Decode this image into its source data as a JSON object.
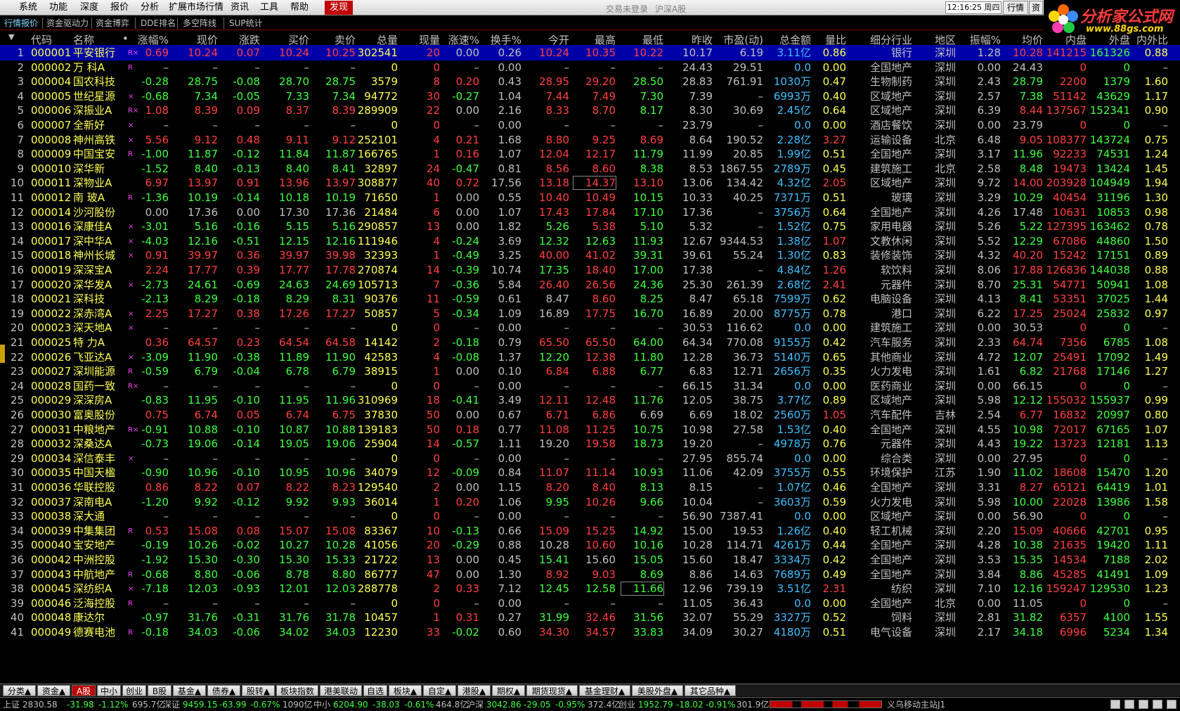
{
  "menu": {
    "items": [
      "系统",
      "功能",
      "深度",
      "报价",
      "分析",
      "扩展市场行情",
      "资讯",
      "工具",
      "帮助"
    ],
    "highlight": "发现",
    "center1": "交易未登录",
    "center2": "沪深A股",
    "clock": "12:16:25 周四",
    "btn_quote": "行情",
    "btn_trade": "资",
    "logo_text": "分析家公式网",
    "logo_url": "www.88gs.com"
  },
  "subtabs": [
    "行情报价",
    "资金驱动力",
    "资金博弈",
    "DDE排名",
    "多空阵线",
    "SUP统计"
  ],
  "headers": [
    "代码",
    "名称",
    "•",
    "涨幅%",
    "现价",
    "涨跌",
    "买价",
    "卖价",
    "总量",
    "现量",
    "涨速%",
    "换手%",
    "今开",
    "最高",
    "最低",
    "昨收",
    "市盈(动)",
    "总金额",
    "量比",
    "细分行业",
    "地区",
    "振幅%",
    "均价",
    "内盘",
    "外盘",
    "内外比"
  ],
  "rows": [
    [
      "1",
      "000001",
      "平安银行",
      "R×",
      "0.69",
      "10.24",
      "0.07",
      "10.24",
      "10.25",
      "302541",
      "20",
      "0.00",
      "0.26",
      "10.24",
      "10.35",
      "10.22",
      "10.17",
      "6.19",
      "3.11亿",
      "0.86",
      "银行",
      "深圳",
      "1.28",
      "10.28",
      "141215",
      "161326",
      "0.88"
    ],
    [
      "2",
      "000002",
      "万 科A",
      "R",
      "–",
      "–",
      "–",
      "–",
      "–",
      "0",
      "0",
      "–",
      "0.00",
      "–",
      "–",
      "–",
      "24.43",
      "29.51",
      "0.0",
      "0.00",
      "全国地产",
      "深圳",
      "0.00",
      "24.43",
      "0",
      "0",
      "–"
    ],
    [
      "3",
      "000004",
      "国农科技",
      "",
      "-0.28",
      "28.75",
      "-0.08",
      "28.70",
      "28.75",
      "3579",
      "8",
      "0.20",
      "0.43",
      "28.95",
      "29.20",
      "28.50",
      "28.83",
      "761.91",
      "1030万",
      "0.47",
      "生物制药",
      "深圳",
      "2.43",
      "28.79",
      "2200",
      "1379",
      "1.60"
    ],
    [
      "4",
      "000005",
      "世纪星源",
      "×",
      "-0.68",
      "7.34",
      "-0.05",
      "7.33",
      "7.34",
      "94772",
      "30",
      "-0.27",
      "1.04",
      "7.44",
      "7.49",
      "7.30",
      "7.39",
      "–",
      "6993万",
      "0.40",
      "区域地产",
      "深圳",
      "2.57",
      "7.38",
      "51142",
      "43629",
      "1.17"
    ],
    [
      "5",
      "000006",
      "深振业A",
      "R×",
      "1.08",
      "8.39",
      "0.09",
      "8.37",
      "8.39",
      "289909",
      "22",
      "0.00",
      "2.16",
      "8.33",
      "8.70",
      "8.17",
      "8.30",
      "30.69",
      "2.45亿",
      "0.64",
      "区域地产",
      "深圳",
      "6.39",
      "8.44",
      "137567",
      "152341",
      "0.90"
    ],
    [
      "6",
      "000007",
      "全新好",
      "×",
      "–",
      "–",
      "–",
      "–",
      "–",
      "0",
      "0",
      "–",
      "0.00",
      "–",
      "–",
      "–",
      "23.79",
      "–",
      "0.0",
      "0.00",
      "酒店餐饮",
      "深圳",
      "0.00",
      "23.79",
      "0",
      "0",
      "–"
    ],
    [
      "7",
      "000008",
      "神州高铁",
      "×",
      "5.56",
      "9.12",
      "0.48",
      "9.11",
      "9.12",
      "252101",
      "4",
      "0.21",
      "1.68",
      "8.80",
      "9.25",
      "8.69",
      "8.64",
      "190.52",
      "2.28亿",
      "3.27",
      "运输设备",
      "北京",
      "6.48",
      "9.05",
      "108377",
      "143724",
      "0.75"
    ],
    [
      "8",
      "000009",
      "中国宝安",
      "R",
      "-1.00",
      "11.87",
      "-0.12",
      "11.84",
      "11.87",
      "166765",
      "1",
      "0.16",
      "1.07",
      "12.04",
      "12.17",
      "11.79",
      "11.99",
      "20.85",
      "1.99亿",
      "0.51",
      "全国地产",
      "深圳",
      "3.17",
      "11.96",
      "92233",
      "74531",
      "1.24"
    ],
    [
      "9",
      "000010",
      "深华新",
      "",
      "-1.52",
      "8.40",
      "-0.13",
      "8.40",
      "8.41",
      "32897",
      "24",
      "-0.47",
      "0.81",
      "8.56",
      "8.60",
      "8.38",
      "8.53",
      "1867.55",
      "2789万",
      "0.45",
      "建筑施工",
      "北京",
      "2.58",
      "8.48",
      "19473",
      "13424",
      "1.45"
    ],
    [
      "10",
      "000011",
      "深物业A",
      "",
      "6.97",
      "13.97",
      "0.91",
      "13.96",
      "13.97",
      "308877",
      "40",
      "0.72",
      "17.56",
      "13.18",
      "14.37",
      "13.10",
      "13.06",
      "134.42",
      "4.32亿",
      "2.05",
      "区域地产",
      "深圳",
      "9.72",
      "14.00",
      "203928",
      "104949",
      "1.94"
    ],
    [
      "11",
      "000012",
      "南 玻A",
      "R",
      "-1.36",
      "10.19",
      "-0.14",
      "10.18",
      "10.19",
      "71650",
      "1",
      "0.00",
      "0.55",
      "10.40",
      "10.49",
      "10.15",
      "10.33",
      "40.25",
      "7371万",
      "0.51",
      "玻璃",
      "深圳",
      "3.29",
      "10.29",
      "40454",
      "31196",
      "1.30"
    ],
    [
      "12",
      "000014",
      "沙河股份",
      "",
      "0.00",
      "17.36",
      "0.00",
      "17.30",
      "17.36",
      "21484",
      "6",
      "0.00",
      "1.07",
      "17.43",
      "17.84",
      "17.10",
      "17.36",
      "–",
      "3756万",
      "0.64",
      "全国地产",
      "深圳",
      "4.26",
      "17.48",
      "10631",
      "10853",
      "0.98"
    ],
    [
      "13",
      "000016",
      "深康佳A",
      "×",
      "-3.01",
      "5.16",
      "-0.16",
      "5.15",
      "5.16",
      "290857",
      "13",
      "0.00",
      "1.82",
      "5.26",
      "5.38",
      "5.10",
      "5.32",
      "–",
      "1.52亿",
      "0.75",
      "家用电器",
      "深圳",
      "5.26",
      "5.22",
      "127395",
      "163462",
      "0.78"
    ],
    [
      "14",
      "000017",
      "深中华A",
      "×",
      "-4.03",
      "12.16",
      "-0.51",
      "12.15",
      "12.16",
      "111946",
      "4",
      "-0.24",
      "3.69",
      "12.32",
      "12.63",
      "11.93",
      "12.67",
      "9344.53",
      "1.38亿",
      "1.07",
      "文教休闲",
      "深圳",
      "5.52",
      "12.29",
      "67086",
      "44860",
      "1.50"
    ],
    [
      "15",
      "000018",
      "神州长城",
      "×",
      "0.91",
      "39.97",
      "0.36",
      "39.97",
      "39.98",
      "32393",
      "1",
      "-0.49",
      "3.25",
      "40.00",
      "41.02",
      "39.31",
      "39.61",
      "55.24",
      "1.30亿",
      "0.83",
      "装修装饰",
      "深圳",
      "4.32",
      "40.20",
      "15242",
      "17151",
      "0.89"
    ],
    [
      "16",
      "000019",
      "深深宝A",
      "",
      "2.24",
      "17.77",
      "0.39",
      "17.77",
      "17.78",
      "270874",
      "14",
      "-0.39",
      "10.74",
      "17.35",
      "18.40",
      "17.00",
      "17.38",
      "–",
      "4.84亿",
      "1.26",
      "软饮料",
      "深圳",
      "8.06",
      "17.88",
      "126836",
      "144038",
      "0.88"
    ],
    [
      "17",
      "000020",
      "深华发A",
      "×",
      "-2.73",
      "24.61",
      "-0.69",
      "24.63",
      "24.69",
      "105713",
      "7",
      "-0.36",
      "5.84",
      "26.40",
      "26.56",
      "24.36",
      "25.30",
      "261.39",
      "2.68亿",
      "2.41",
      "元器件",
      "深圳",
      "8.70",
      "25.31",
      "54771",
      "50941",
      "1.08"
    ],
    [
      "18",
      "000021",
      "深科技",
      "",
      "-2.13",
      "8.29",
      "-0.18",
      "8.29",
      "8.31",
      "90376",
      "11",
      "-0.59",
      "0.61",
      "8.47",
      "8.60",
      "8.25",
      "8.47",
      "65.18",
      "7599万",
      "0.62",
      "电脑设备",
      "深圳",
      "4.13",
      "8.41",
      "53351",
      "37025",
      "1.44"
    ],
    [
      "19",
      "000022",
      "深赤湾A",
      "×",
      "2.25",
      "17.27",
      "0.38",
      "17.26",
      "17.27",
      "50857",
      "5",
      "-0.34",
      "1.09",
      "16.89",
      "17.75",
      "16.70",
      "16.89",
      "20.00",
      "8775万",
      "0.78",
      "港口",
      "深圳",
      "6.22",
      "17.25",
      "25024",
      "25832",
      "0.97"
    ],
    [
      "20",
      "000023",
      "深天地A",
      "×",
      "–",
      "–",
      "–",
      "–",
      "–",
      "0",
      "0",
      "–",
      "0.00",
      "–",
      "–",
      "–",
      "30.53",
      "116.62",
      "0.0",
      "0.00",
      "建筑施工",
      "深圳",
      "0.00",
      "30.53",
      "0",
      "0",
      "–"
    ],
    [
      "21",
      "000025",
      "特 力A",
      "",
      "0.36",
      "64.57",
      "0.23",
      "64.54",
      "64.58",
      "14142",
      "2",
      "-0.18",
      "0.79",
      "65.50",
      "65.50",
      "64.00",
      "64.34",
      "770.08",
      "9155万",
      "0.42",
      "汽车服务",
      "深圳",
      "2.33",
      "64.74",
      "7356",
      "6785",
      "1.08"
    ],
    [
      "22",
      "000026",
      "飞亚达A",
      "×",
      "-3.09",
      "11.90",
      "-0.38",
      "11.89",
      "11.90",
      "42583",
      "4",
      "-0.08",
      "1.37",
      "12.20",
      "12.38",
      "11.80",
      "12.28",
      "36.73",
      "5140万",
      "0.65",
      "其他商业",
      "深圳",
      "4.72",
      "12.07",
      "25491",
      "17092",
      "1.49"
    ],
    [
      "23",
      "000027",
      "深圳能源",
      "R",
      "-0.59",
      "6.79",
      "-0.04",
      "6.78",
      "6.79",
      "38915",
      "1",
      "0.00",
      "0.10",
      "6.84",
      "6.88",
      "6.77",
      "6.83",
      "12.71",
      "2656万",
      "0.35",
      "火力发电",
      "深圳",
      "1.61",
      "6.82",
      "21768",
      "17146",
      "1.27"
    ],
    [
      "24",
      "000028",
      "国药一致",
      "R×",
      "–",
      "–",
      "–",
      "–",
      "–",
      "0",
      "0",
      "–",
      "0.00",
      "–",
      "–",
      "–",
      "66.15",
      "31.34",
      "0.0",
      "0.00",
      "医药商业",
      "深圳",
      "0.00",
      "66.15",
      "0",
      "0",
      "–"
    ],
    [
      "25",
      "000029",
      "深深房A",
      "",
      "-0.83",
      "11.95",
      "-0.10",
      "11.95",
      "11.96",
      "310969",
      "18",
      "-0.41",
      "3.49",
      "12.11",
      "12.48",
      "11.76",
      "12.05",
      "38.75",
      "3.77亿",
      "0.89",
      "区域地产",
      "深圳",
      "5.98",
      "12.12",
      "155032",
      "155937",
      "0.99"
    ],
    [
      "26",
      "000030",
      "富奥股份",
      "",
      "0.75",
      "6.74",
      "0.05",
      "6.74",
      "6.75",
      "37830",
      "50",
      "0.00",
      "0.67",
      "6.71",
      "6.86",
      "6.69",
      "6.69",
      "18.02",
      "2560万",
      "1.05",
      "汽车配件",
      "吉林",
      "2.54",
      "6.77",
      "16832",
      "20997",
      "0.80"
    ],
    [
      "27",
      "000031",
      "中粮地产",
      "R×",
      "-0.91",
      "10.88",
      "-0.10",
      "10.87",
      "10.88",
      "139183",
      "50",
      "0.18",
      "0.77",
      "11.08",
      "11.25",
      "10.75",
      "10.98",
      "27.58",
      "1.53亿",
      "0.40",
      "全国地产",
      "深圳",
      "4.55",
      "10.98",
      "72017",
      "67165",
      "1.07"
    ],
    [
      "28",
      "000032",
      "深桑达A",
      "",
      "-0.73",
      "19.06",
      "-0.14",
      "19.05",
      "19.06",
      "25904",
      "14",
      "-0.57",
      "1.11",
      "19.20",
      "19.58",
      "18.73",
      "19.20",
      "–",
      "4978万",
      "0.76",
      "元器件",
      "深圳",
      "4.43",
      "19.22",
      "13723",
      "12181",
      "1.13"
    ],
    [
      "29",
      "000034",
      "深信泰丰",
      "×",
      "–",
      "–",
      "–",
      "–",
      "–",
      "0",
      "0",
      "–",
      "0.00",
      "–",
      "–",
      "–",
      "27.95",
      "855.74",
      "0.0",
      "0.00",
      "综合类",
      "深圳",
      "0.00",
      "27.95",
      "0",
      "0",
      "–"
    ],
    [
      "30",
      "000035",
      "中国天楹",
      "",
      "-0.90",
      "10.96",
      "-0.10",
      "10.95",
      "10.96",
      "34079",
      "12",
      "-0.09",
      "0.84",
      "11.07",
      "11.14",
      "10.93",
      "11.06",
      "42.09",
      "3755万",
      "0.55",
      "环境保护",
      "江苏",
      "1.90",
      "11.02",
      "18608",
      "15470",
      "1.20"
    ],
    [
      "31",
      "000036",
      "华联控股",
      "",
      "0.86",
      "8.22",
      "0.07",
      "8.22",
      "8.23",
      "129540",
      "2",
      "0.00",
      "1.15",
      "8.20",
      "8.40",
      "8.13",
      "8.15",
      "–",
      "1.07亿",
      "0.46",
      "全国地产",
      "深圳",
      "3.31",
      "8.27",
      "65121",
      "64419",
      "1.01"
    ],
    [
      "32",
      "000037",
      "深南电A",
      "",
      "-1.20",
      "9.92",
      "-0.12",
      "9.92",
      "9.93",
      "36014",
      "1",
      "0.20",
      "1.06",
      "9.95",
      "10.26",
      "9.66",
      "10.04",
      "–",
      "3603万",
      "0.59",
      "火力发电",
      "深圳",
      "5.98",
      "10.00",
      "22028",
      "13986",
      "1.58"
    ],
    [
      "33",
      "000038",
      "深大通",
      "",
      "–",
      "–",
      "–",
      "–",
      "–",
      "0",
      "0",
      "–",
      "0.00",
      "–",
      "–",
      "–",
      "56.90",
      "7387.41",
      "0.0",
      "0.00",
      "区域地产",
      "深圳",
      "0.00",
      "56.90",
      "0",
      "0",
      "–"
    ],
    [
      "34",
      "000039",
      "中集集团",
      "R",
      "0.53",
      "15.08",
      "0.08",
      "15.07",
      "15.08",
      "83367",
      "10",
      "-0.13",
      "0.66",
      "15.09",
      "15.25",
      "14.92",
      "15.00",
      "19.53",
      "1.26亿",
      "0.40",
      "轻工机械",
      "深圳",
      "2.20",
      "15.09",
      "40666",
      "42701",
      "0.95"
    ],
    [
      "35",
      "000040",
      "宝安地产",
      "",
      "-0.19",
      "10.26",
      "-0.02",
      "10.27",
      "10.28",
      "41056",
      "20",
      "-0.29",
      "0.88",
      "10.28",
      "10.60",
      "10.16",
      "10.28",
      "114.71",
      "4261万",
      "0.44",
      "全国地产",
      "深圳",
      "4.28",
      "10.38",
      "21635",
      "19420",
      "1.11"
    ],
    [
      "36",
      "000042",
      "中洲控股",
      "",
      "-1.92",
      "15.30",
      "-0.30",
      "15.30",
      "15.33",
      "21722",
      "13",
      "0.00",
      "0.45",
      "15.41",
      "15.60",
      "15.05",
      "15.60",
      "18.47",
      "3334万",
      "0.42",
      "全国地产",
      "深圳",
      "3.53",
      "15.35",
      "14534",
      "7188",
      "2.02"
    ],
    [
      "37",
      "000043",
      "中航地产",
      "R",
      "-0.68",
      "8.80",
      "-0.06",
      "8.78",
      "8.80",
      "86777",
      "47",
      "0.00",
      "1.30",
      "8.92",
      "9.03",
      "8.69",
      "8.86",
      "14.63",
      "7689万",
      "0.49",
      "全国地产",
      "深圳",
      "3.84",
      "8.86",
      "45285",
      "41491",
      "1.09"
    ],
    [
      "38",
      "000045",
      "深纺织A",
      "×",
      "-7.18",
      "12.03",
      "-0.93",
      "12.01",
      "12.03",
      "288778",
      "2",
      "0.33",
      "7.12",
      "12.45",
      "12.58",
      "11.66",
      "12.96",
      "739.19",
      "3.51亿",
      "2.31",
      "纺织",
      "深圳",
      "7.10",
      "12.16",
      "159247",
      "129530",
      "1.23"
    ],
    [
      "39",
      "000046",
      "泛海控股",
      "R",
      "–",
      "–",
      "–",
      "–",
      "–",
      "0",
      "0",
      "–",
      "0.00",
      "–",
      "–",
      "–",
      "11.05",
      "36.43",
      "0.0",
      "0.00",
      "全国地产",
      "北京",
      "0.00",
      "11.05",
      "0",
      "0",
      "–"
    ],
    [
      "40",
      "000048",
      "康达尔",
      "",
      "-0.97",
      "31.76",
      "-0.31",
      "31.76",
      "31.78",
      "10457",
      "1",
      "0.31",
      "0.27",
      "31.99",
      "32.46",
      "31.56",
      "32.07",
      "55.29",
      "3327万",
      "0.52",
      "饲料",
      "深圳",
      "2.81",
      "31.82",
      "6357",
      "4100",
      "1.55"
    ],
    [
      "41",
      "000049",
      "德赛电池",
      "R",
      "-0.18",
      "34.03",
      "-0.06",
      "34.02",
      "34.03",
      "12230",
      "33",
      "-0.02",
      "0.60",
      "34.30",
      "34.57",
      "33.83",
      "34.09",
      "30.27",
      "4180万",
      "0.51",
      "电气设备",
      "深圳",
      "2.17",
      "34.18",
      "6996",
      "5234",
      "1.34"
    ]
  ],
  "bottom_tabs": [
    "分类▲",
    "资金▲",
    "A股",
    "中小",
    "创业",
    "B股",
    "基金▲",
    "债券▲",
    "股转▲",
    "板块指数",
    "港美联动",
    "自选",
    "板块▲",
    "自定▲",
    "港股▲",
    "期权▲",
    "期货现货▲",
    "基金理财▲",
    "美股外盘▲",
    "其它品种▲"
  ],
  "status": {
    "sh_label": "上证",
    "sh_val": "2830.58",
    "sh_chg": "-31.98",
    "sh_pct": "-1.12%",
    "sh_amt": "695.7亿",
    "sz_label": "深证",
    "sz_val": "9459.15",
    "sz_chg": "-63.99",
    "sz_pct": "-0.67%",
    "sz_amt": "1090亿",
    "zx_label": "中小",
    "zx_val": "6204.90",
    "zx_chg": "-38.03",
    "zx_pct": "-0.61%",
    "zx_amt": "464.8亿",
    "hs_label": "沪深",
    "hs_val": "3042.86",
    "hs_chg": "-29.05",
    "hs_pct": "-0.95%",
    "hs_amt": "372.4亿",
    "cy_label": "创业",
    "cy_val": "1952.79",
    "cy_chg": "-18.02",
    "cy_pct": "-0.91%",
    "cy_amt": "301.9亿",
    "station": "义乌移动主站J1"
  }
}
